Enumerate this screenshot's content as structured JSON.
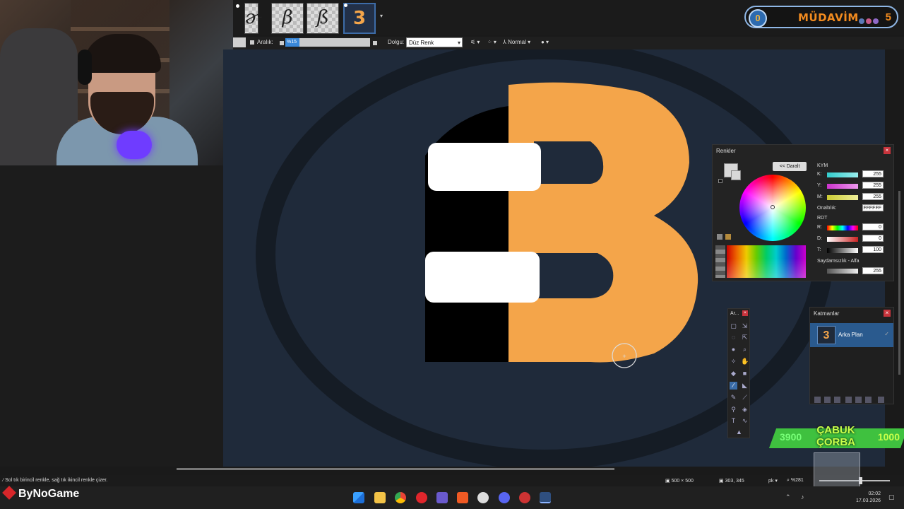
{
  "toolbar": {
    "spacing_label": "Aralık:",
    "spacing_value": "%15",
    "fill_label": "Dolgu:",
    "fill_value": "Düz Renk",
    "blend_mode": "Normal"
  },
  "colors_panel": {
    "title": "Renkler",
    "collapse_button": "<< Daralt",
    "hsv_header": "KYM",
    "k_label": "K:",
    "k_value": "255",
    "y_label": "Y:",
    "y_value": "255",
    "m_label": "M:",
    "m_value": "255",
    "hex_label": "Onaltılık:",
    "hex_value": "FFFFFF",
    "rgb_header": "RDT",
    "r_label": "R:",
    "r_value": "0",
    "d_label": "D:",
    "d_value": "0",
    "t_label": "T:",
    "t_value": "100",
    "alpha_header": "Saydamsızlık - Alfa",
    "alpha_value": "255",
    "primary_color": "#D8D8D8"
  },
  "tools_panel": {
    "title": "Ar..."
  },
  "layers_panel": {
    "title": "Katmanlar",
    "layers": [
      {
        "name": "Arka Plan",
        "visible": true
      }
    ]
  },
  "statusbar": {
    "hint": "Sol tık birincil renkle, sağ tık ikincil renkle çizer.",
    "image_size": "500 × 500",
    "cursor_pos": "303, 345",
    "units": "pk",
    "zoom": "%281"
  },
  "overlay_mudavim": {
    "count_left": "0",
    "label": "MÜDAVİM",
    "count_right": "5"
  },
  "overlay_goal": {
    "current": "3900",
    "line1": "ÇABUK",
    "line2": "ÇORBA",
    "target": "1000"
  },
  "taskbar": {
    "brand": "ByNoGame",
    "time": "02:02",
    "date": "17.03.2026"
  },
  "colors": {
    "canvas_bg": "#1F2A3A",
    "logo_orange": "#F4A54A",
    "accent_blue": "#2A5A8E"
  }
}
